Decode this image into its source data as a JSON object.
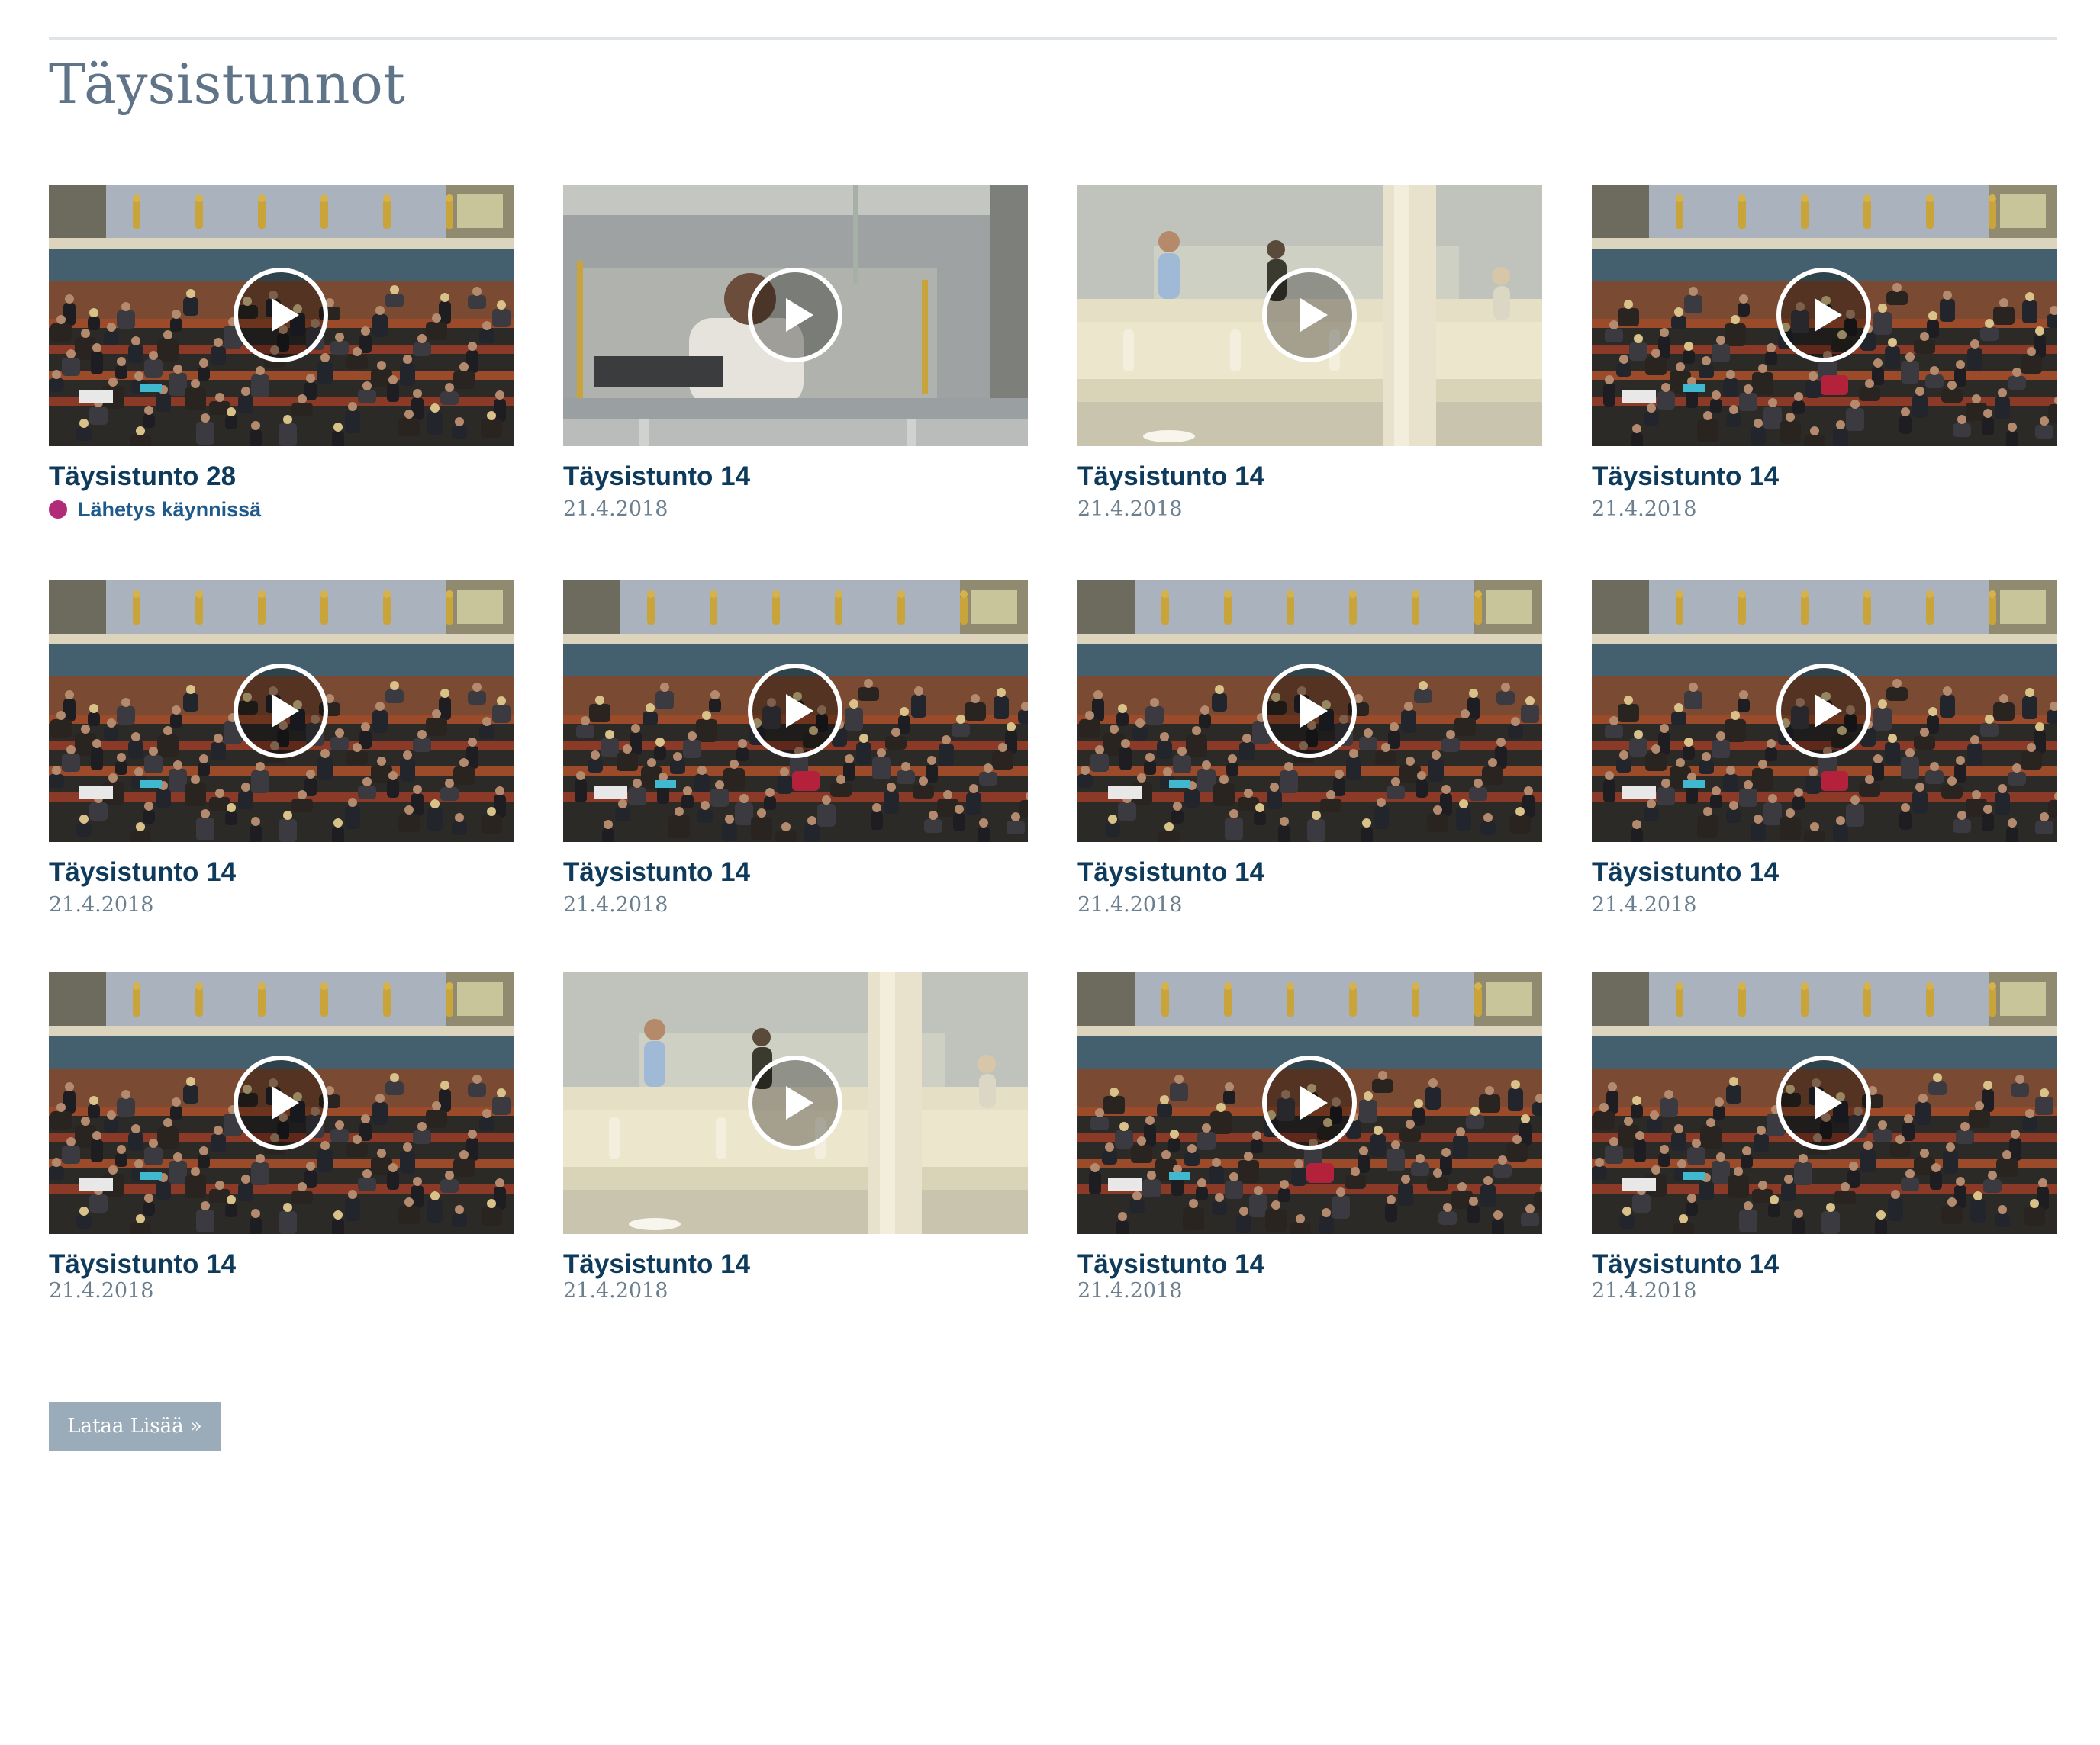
{
  "page": {
    "title": "Täysistunnot"
  },
  "videos": [
    {
      "title": "Täysistunto 28",
      "date": "",
      "live_label": "Lähetys käynnissä",
      "scene": "chamber-a"
    },
    {
      "title": "Täysistunto 14",
      "date": "21.4.2018",
      "scene": "podium"
    },
    {
      "title": "Täysistunto 14",
      "date": "21.4.2018",
      "scene": "gallery"
    },
    {
      "title": "Täysistunto 14",
      "date": "21.4.2018",
      "scene": "chamber-b"
    },
    {
      "title": "Täysistunto 14",
      "date": "21.4.2018",
      "scene": "chamber-a"
    },
    {
      "title": "Täysistunto 14",
      "date": "21.4.2018",
      "scene": "chamber-b"
    },
    {
      "title": "Täysistunto 14",
      "date": "21.4.2018",
      "scene": "chamber-a"
    },
    {
      "title": "Täysistunto 14",
      "date": "21.4.2018",
      "scene": "chamber-b"
    },
    {
      "title": "Täysistunto 14",
      "date": "21.4.2018",
      "scene": "chamber-a"
    },
    {
      "title": "Täysistunto 14",
      "date": "21.4.2018",
      "scene": "gallery"
    },
    {
      "title": "Täysistunto 14",
      "date": "21.4.2018",
      "scene": "chamber-b"
    },
    {
      "title": "Täysistunto 14",
      "date": "21.4.2018",
      "scene": "chamber-a"
    }
  ],
  "icons": {
    "play": "play-icon",
    "live": "live-dot-icon"
  },
  "colors": {
    "title": "#0e3a5b",
    "heading": "#5f7488",
    "live": "#b12b79",
    "button": "#9aabb9"
  },
  "load_more": {
    "label": "Lataa Lisää »"
  }
}
